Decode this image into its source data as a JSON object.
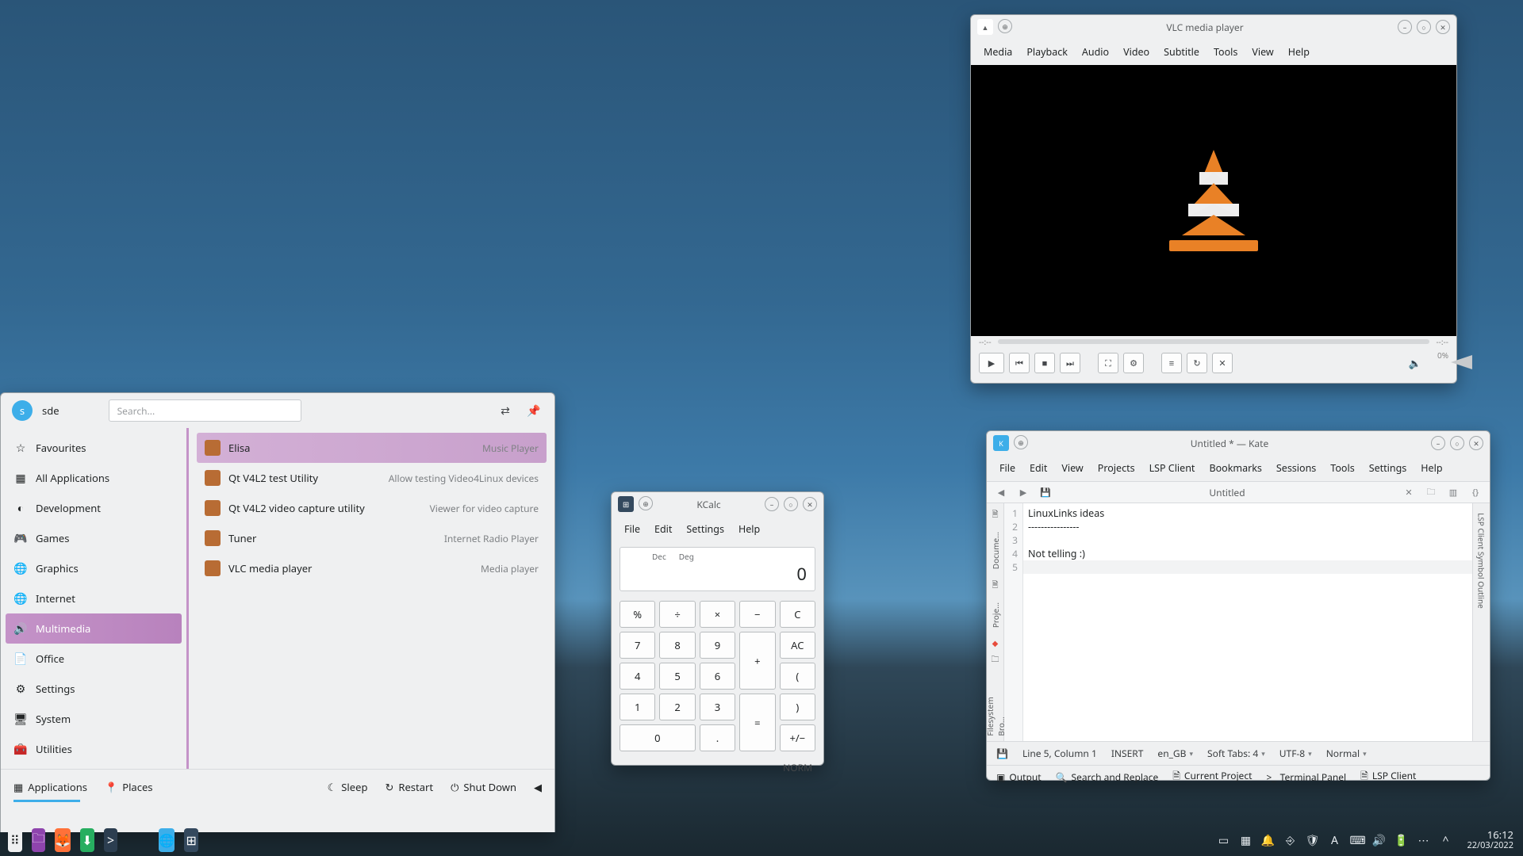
{
  "vlc": {
    "title": "VLC media player",
    "menus": [
      "Media",
      "Playback",
      "Audio",
      "Video",
      "Subtitle",
      "Tools",
      "View",
      "Help"
    ],
    "time_left": "--:--",
    "time_right": "--:--",
    "volume": "0%"
  },
  "kate": {
    "title": "Untitled * — Kate",
    "menus": [
      "File",
      "Edit",
      "View",
      "Projects",
      "LSP Client",
      "Bookmarks",
      "Sessions",
      "Tools",
      "Settings",
      "Help"
    ],
    "tab": "Untitled",
    "side_left": [
      "Docume…",
      "Proje…",
      "Filesystem Bro…"
    ],
    "side_right": "LSP Client Symbol Outline",
    "lines": [
      "LinuxLinks ideas",
      "----------------",
      "",
      "Not telling :)",
      ""
    ],
    "gutter": [
      "1",
      "2",
      "3",
      "4",
      "5"
    ],
    "status": {
      "pos": "Line 5, Column 1",
      "mode": "INSERT",
      "lang": "en_GB",
      "tabs": "Soft Tabs: 4",
      "enc": "UTF-8",
      "vim": "Normal"
    },
    "tools": [
      "Output",
      "Search and Replace",
      "Current Project",
      "Terminal Panel",
      "LSP Client"
    ]
  },
  "kcalc": {
    "title": "KCalc",
    "menus": [
      "File",
      "Edit",
      "Settings",
      "Help"
    ],
    "modes": [
      "Dec",
      "Deg"
    ],
    "value": "0",
    "norm": "NORM",
    "keys": [
      "%",
      "÷",
      "×",
      "−",
      "C",
      "7",
      "8",
      "9",
      "+",
      "AC",
      "4",
      "5",
      "6",
      "(",
      "1",
      "2",
      "3",
      "=",
      ")",
      "0",
      ".",
      "+/−"
    ]
  },
  "menu": {
    "user_initial": "s",
    "user": "sde",
    "search_placeholder": "Search...",
    "cats": [
      {
        "icon": "☆",
        "label": "Favourites"
      },
      {
        "icon": "▦",
        "label": "All Applications"
      },
      {
        "icon": "◐",
        "label": "Development"
      },
      {
        "icon": "🎮",
        "label": "Games"
      },
      {
        "icon": "🌐",
        "label": "Graphics"
      },
      {
        "icon": "🌐",
        "label": "Internet"
      },
      {
        "icon": "🔊",
        "label": "Multimedia"
      },
      {
        "icon": "📄",
        "label": "Office"
      },
      {
        "icon": "⚙",
        "label": "Settings"
      },
      {
        "icon": "🖥",
        "label": "System"
      },
      {
        "icon": "🧰",
        "label": "Utilities"
      }
    ],
    "cat_selected": 6,
    "apps": [
      {
        "name": "Elisa",
        "desc": "Music Player",
        "sel": true
      },
      {
        "name": "Qt V4L2 test Utility",
        "desc": "Allow testing Video4Linux devices"
      },
      {
        "name": "Qt V4L2 video capture utility",
        "desc": "Viewer for video capture"
      },
      {
        "name": "Tuner",
        "desc": "Internet Radio Player"
      },
      {
        "name": "VLC media player",
        "desc": "Media player"
      }
    ],
    "footer_left": [
      {
        "icon": "▦",
        "label": "Applications"
      },
      {
        "icon": "📍",
        "label": "Places"
      }
    ],
    "footer_right": [
      {
        "icon": "☾",
        "label": "Sleep"
      },
      {
        "icon": "↻",
        "label": "Restart"
      },
      {
        "icon": "⏻",
        "label": "Shut Down"
      },
      {
        "icon": "◀",
        "label": ""
      }
    ]
  },
  "taskbar": {
    "items": [
      {
        "name": "launcher",
        "bg": "#eff0f1",
        "glyph": "⠿"
      },
      {
        "name": "files",
        "bg": "#8e44ad",
        "glyph": "🗀"
      },
      {
        "name": "firefox",
        "bg": "#ff7139",
        "glyph": "🦊"
      },
      {
        "name": "downloads",
        "bg": "#27ae60",
        "glyph": "⬇"
      },
      {
        "name": "terminal",
        "bg": "#2c3e50",
        "glyph": ">"
      },
      {
        "name": "web",
        "bg": "#3daee9",
        "glyph": "🌐"
      },
      {
        "name": "calc",
        "bg": "#34495e",
        "glyph": "⊞"
      }
    ]
  },
  "tray": {
    "icons": [
      "▭",
      "▦",
      "🔔",
      "⎆",
      "🛡",
      "A",
      "⌨",
      "🔊",
      "🔋",
      "⋯",
      "^"
    ],
    "time": "16:12",
    "date": "22/03/2022"
  }
}
